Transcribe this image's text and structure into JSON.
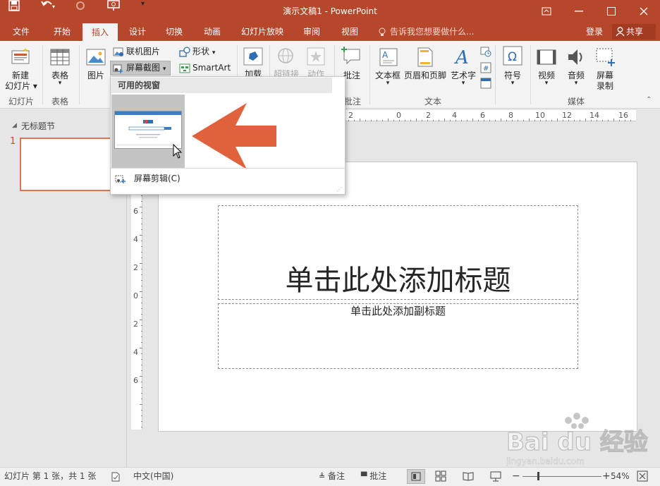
{
  "window": {
    "title": "演示文稿1 - PowerPoint"
  },
  "tabs": [
    "文件",
    "开始",
    "插入",
    "设计",
    "切换",
    "动画",
    "幻灯片放映",
    "审阅",
    "视图"
  ],
  "tell_me": "告诉我您想要做什么...",
  "account": {
    "login": "登录",
    "share": "共享"
  },
  "ribbon": {
    "slides": {
      "new_slide": "新建",
      "new_slide_2": "幻灯片",
      "group": "幻灯片"
    },
    "tables": {
      "table": "表格",
      "group": "表格"
    },
    "images": {
      "picture": "图片",
      "online_pictures": "联机图片",
      "screenshot": "屏幕截图"
    },
    "illustrations": {
      "shapes": "形状",
      "smartart": "SmartArt"
    },
    "addins": {
      "addins": "加载"
    },
    "links": {
      "link": "超链接",
      "action": "动作"
    },
    "comments": {
      "comment": "批注",
      "group": "批注"
    },
    "text": {
      "textbox": "文本框",
      "header_footer": "页眉和页脚",
      "wordart": "艺术字",
      "group": "文本"
    },
    "symbols": {
      "symbol": "符号"
    },
    "media": {
      "video": "视频",
      "audio": "音频",
      "screen_rec": "屏幕",
      "screen_rec_2": "录制",
      "group": "媒体"
    }
  },
  "left_pane": {
    "section": "无标题节",
    "slide_number": "1"
  },
  "hruler_labels": [
    "2",
    "0",
    "2",
    "4",
    "6",
    "8",
    "10",
    "12",
    "14",
    "16"
  ],
  "vruler_labels": [
    "6",
    "4",
    "2",
    "0",
    "2",
    "4",
    "6"
  ],
  "slide": {
    "title_placeholder": "单击此处添加标题",
    "subtitle_placeholder": "单击此处添加副标题"
  },
  "dropdown": {
    "header": "可用的视窗",
    "screen_clipping": "屏幕剪辑(C)"
  },
  "status": {
    "slide_info": "幻灯片 第 1 张，共 1 张",
    "language": "中文(中国)",
    "notes": "备注",
    "comments": "批注",
    "zoom": "54%"
  },
  "watermark": {
    "text": "Bai du 经验",
    "url": "jingyan.baidu.com"
  },
  "colors": {
    "accent": "#b7472a",
    "arrow": "#e0623c",
    "slide_border": "#e2734f"
  }
}
